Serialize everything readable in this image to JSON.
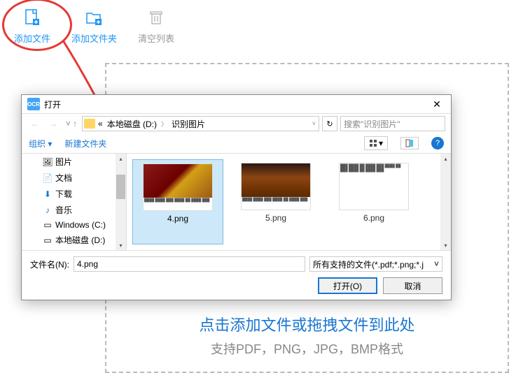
{
  "toolbar": {
    "add_file": "添加文件",
    "add_folder": "添加文件夹",
    "clear_list": "清空列表"
  },
  "dropzone": {
    "main": "点击添加文件或拖拽文件到此处",
    "sub": "支持PDF，PNG，JPG，BMP格式"
  },
  "dialog": {
    "title": "打开",
    "breadcrumb_prefix": "«",
    "breadcrumb_drive": "本地磁盘 (D:)",
    "breadcrumb_folder": "识别图片",
    "search_placeholder": "搜索\"识别图片\"",
    "organize": "组织",
    "new_folder": "新建文件夹",
    "tree": {
      "pictures": "图片",
      "documents": "文档",
      "downloads": "下载",
      "music": "音乐",
      "windows_c": "Windows (C:)",
      "local_d": "本地磁盘 (D:)"
    },
    "files": {
      "f1": "4.png",
      "f2": "5.png",
      "f3": "6.png"
    },
    "filename_label": "文件名(N):",
    "filename_value": "4.png",
    "filter": "所有支持的文件(*.pdf;*.png;*.j",
    "open_btn": "打开(O)",
    "cancel_btn": "取消"
  }
}
